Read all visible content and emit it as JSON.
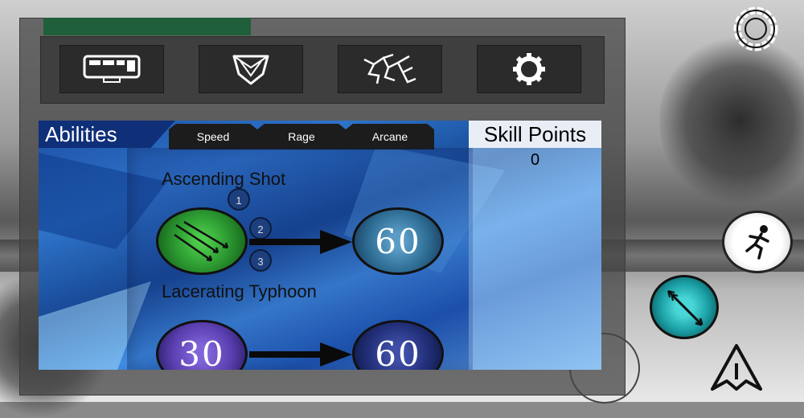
{
  "colors": {
    "health_bar": "#1f5f3a",
    "ability_panel": "#2e73c9",
    "ability_title_bg": "#0f2f78",
    "skill_orb_active": "#2fa034",
    "skill_orb_locked": "#2f6f96",
    "skill_orb_purple": "#5a3fb0"
  },
  "toolbar": {
    "buttons": [
      {
        "icon": "inventory-panel-icon"
      },
      {
        "icon": "armor-shield-icon"
      },
      {
        "icon": "skill-tree-icon"
      },
      {
        "icon": "settings-gear-icon"
      }
    ]
  },
  "abilities": {
    "title": "Abilities",
    "tabs": [
      "Speed",
      "Rage",
      "Arcane"
    ],
    "skill_points_label": "Skill Points",
    "skill_points_value": "0",
    "skills": [
      {
        "name": "Ascending Shot",
        "levels": [
          "1",
          "2",
          "3"
        ],
        "upgrade_cost": "60"
      },
      {
        "name": "Lacerating Typhoon",
        "current_value": "30",
        "upgrade_cost": "60"
      }
    ]
  },
  "hud": {
    "settings_icon": "settings-ring-icon",
    "sprint_icon": "sprint-runner-icon",
    "arrow_skill_icon": "arrow-skill-icon",
    "camp_icon": "camp-tent-icon"
  }
}
